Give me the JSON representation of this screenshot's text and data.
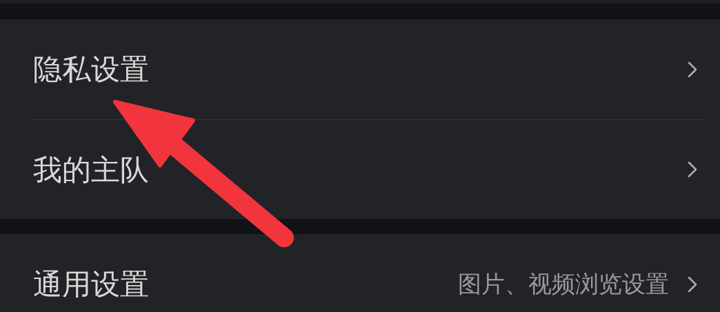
{
  "sections": [
    {
      "items": [
        {
          "label": "隐私设置"
        },
        {
          "label": "我的主队"
        }
      ]
    },
    {
      "items": [
        {
          "label": "通用设置",
          "detail": "图片、视频浏览设置"
        }
      ]
    }
  ]
}
